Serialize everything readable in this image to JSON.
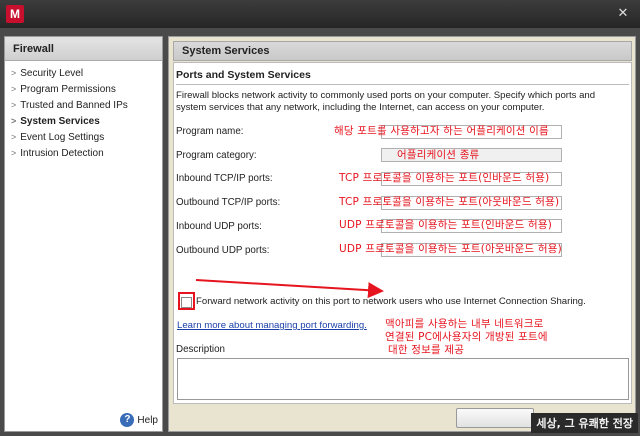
{
  "window": {
    "logo_letter": "M",
    "close_glyph": "✕"
  },
  "sidebar": {
    "title": "Firewall",
    "items": [
      {
        "label": "Security Level"
      },
      {
        "label": "Program Permissions"
      },
      {
        "label": "Trusted and Banned IPs"
      },
      {
        "label": "System Services",
        "active": true
      },
      {
        "label": "Event Log Settings"
      },
      {
        "label": "Intrusion Detection"
      }
    ],
    "help_label": "Help",
    "help_icon": "?"
  },
  "main": {
    "header": "System Services",
    "section_title": "Ports and System Services",
    "description": "Firewall blocks network activity to commonly used ports on your computer. Specify which ports and system services that any network, including the Internet, can access on your computer.",
    "fields": {
      "program_name": "Program name:",
      "program_category": "Program category:",
      "inbound_tcp": "Inbound TCP/IP ports:",
      "outbound_tcp": "Outbound TCP/IP ports:",
      "inbound_udp": "Inbound UDP ports:",
      "outbound_udp": "Outbound UDP ports:"
    },
    "forward_label": "Forward network activity on this port to network users who use Internet Connection Sharing.",
    "learn_more": "Learn more about managing port forwarding.",
    "desc_label": "Description"
  },
  "annotations": {
    "program_name": "해당 포트를 사용하고자 하는 어플리케이션 이름",
    "program_category": "어플리케이션 종류",
    "inbound_tcp": "TCP 프로토콜을 이용하는 포트(인바운드 허용)",
    "outbound_tcp": "TCP 프로토콜을 이용하는 포트(아웃바운드 허용)",
    "inbound_udp": "UDP 프로토콜을 이용하는 포트(인바운드 허용)",
    "outbound_udp": "UDP 프로토콜을 이용하는 포트(아웃바운드 허용)",
    "forward_line1": "맥아피를 사용하는 내부 네트워크로",
    "forward_line2": "연결된 PC에사용자의 개방된 포트에",
    "forward_line3": "대한 정보를 제공",
    "color": "#e6141e"
  },
  "watermark": "세상, 그 유쾌한 전장"
}
